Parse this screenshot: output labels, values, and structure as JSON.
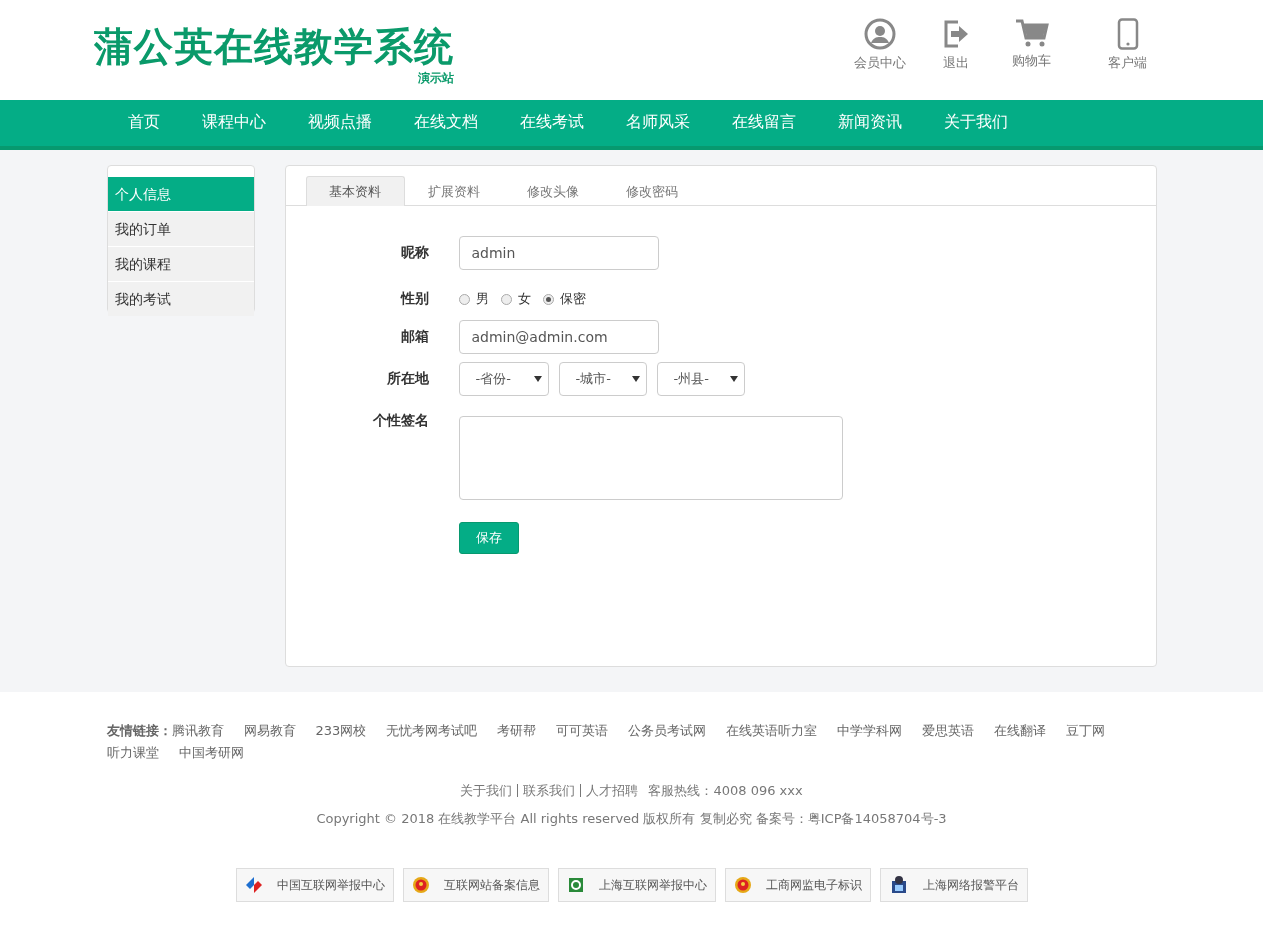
{
  "header": {
    "logo": "蒲公英在线教学系统",
    "logo_sub": "演示站",
    "actions": [
      {
        "kind": "user",
        "label": "会员中心"
      },
      {
        "kind": "exit",
        "label": "退出"
      },
      {
        "kind": "cart",
        "label": "购物车"
      },
      {
        "kind": "phone",
        "label": "客户端"
      }
    ]
  },
  "nav": [
    "首页",
    "课程中心",
    "视频点播",
    "在线文档",
    "在线考试",
    "名师风采",
    "在线留言",
    "新闻资讯",
    "关于我们"
  ],
  "sidebar": {
    "items": [
      {
        "label": "个人信息",
        "selected": true
      },
      {
        "label": "我的订单",
        "selected": false
      },
      {
        "label": "我的课程",
        "selected": false
      },
      {
        "label": "我的考试",
        "selected": false
      }
    ]
  },
  "tabs": [
    {
      "label": "基本资料",
      "selected": true
    },
    {
      "label": "扩展资料",
      "selected": false
    },
    {
      "label": "修改头像",
      "selected": false
    },
    {
      "label": "修改密码",
      "selected": false
    }
  ],
  "form": {
    "nickname": {
      "label": "昵称",
      "value": "admin"
    },
    "gender": {
      "label": "性别",
      "options": [
        {
          "label": "男",
          "selected": false
        },
        {
          "label": "女",
          "selected": false
        },
        {
          "label": "保密",
          "selected": true
        }
      ]
    },
    "email": {
      "label": "邮箱",
      "value": "admin@admin.com"
    },
    "location": {
      "label": "所在地",
      "selects": [
        "-省份-",
        "-城市-",
        "-州县-"
      ]
    },
    "signature": {
      "label": "个性签名"
    },
    "save": "保存"
  },
  "footer": {
    "links_label": "友情链接：",
    "links": [
      "腾讯教育",
      "网易教育",
      "233网校",
      "无忧考网考试吧",
      "考研帮",
      "可可英语",
      "公务员考试网",
      "在线英语听力室",
      "中学学科网",
      "爱思英语",
      "在线翻译",
      "豆丁网",
      "听力课堂",
      "中国考研网"
    ],
    "bottom_links": [
      "关于我们",
      "联系我们",
      "人才招聘"
    ],
    "hotline": "客服热线：4008 096 xxx",
    "copyright": "Copyright © 2018 在线教学平台 All rights reserved 版权所有 复制必究 备案号：粤ICP备14058704号-3",
    "badges": [
      {
        "kind": "report",
        "label": "中国互联网举报中心"
      },
      {
        "kind": "emblem",
        "label": "互联网站备案信息"
      },
      {
        "kind": "e",
        "label": "上海互联网举报中心"
      },
      {
        "kind": "emblem",
        "label": "工商网监电子标识"
      },
      {
        "kind": "police",
        "label": "上海网络报警平台"
      }
    ]
  }
}
